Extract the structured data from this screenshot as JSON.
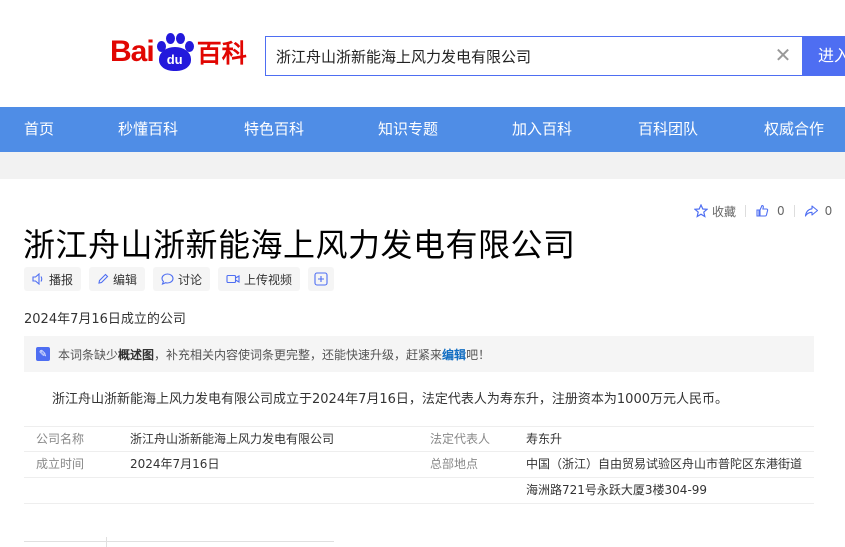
{
  "logo": {
    "text_bai": "Bai",
    "text_du": "du",
    "text_baike": "百科"
  },
  "search": {
    "value": "浙江舟山浙新能海上风力发电有限公司",
    "enter_label": "进入"
  },
  "nav": {
    "items": [
      "首页",
      "秒懂百科",
      "特色百科",
      "知识专题",
      "加入百科",
      "百科团队",
      "权威合作"
    ]
  },
  "top_actions": {
    "collect_label": "收藏",
    "like_count": "0",
    "share_count": "0"
  },
  "page_title": "浙江舟山浙新能海上风力发电有限公司",
  "toolbar": {
    "broadcast": "播报",
    "edit": "编辑",
    "discuss": "讨论",
    "upload_video": "上传视频",
    "plus": "+"
  },
  "found_line": "2024年7月16日成立的公司",
  "notice": {
    "prefix": "本词条缺少",
    "highlight": "概述图",
    "middle": "，补充相关内容使词条更完整，还能快速升级，赶紧来",
    "link": "编辑",
    "suffix": "吧！"
  },
  "summary": "浙江舟山浙新能海上风力发电有限公司成立于2024年7月16日，法定代表人为寿东升，注册资本为1000万元人民币。",
  "info_box": {
    "company_name_key": "公司名称",
    "company_name_val": "浙江舟山浙新能海上风力发电有限公司",
    "legal_rep_key": "法定代表人",
    "legal_rep_val": "寿东升",
    "founded_key": "成立时间",
    "founded_val": "2024年7月16日",
    "hq_key": "总部地点",
    "hq_val_line1": "中国（浙江）自由贸易试验区舟山市普陀区东港街道",
    "hq_val_line2": "海洲路721号永跃大厦3楼304-99"
  },
  "colors": {
    "brand_red": "#e10602",
    "brand_blue": "#2319dc",
    "nav_blue": "#4f8de6",
    "accent": "#4e6ef2"
  }
}
